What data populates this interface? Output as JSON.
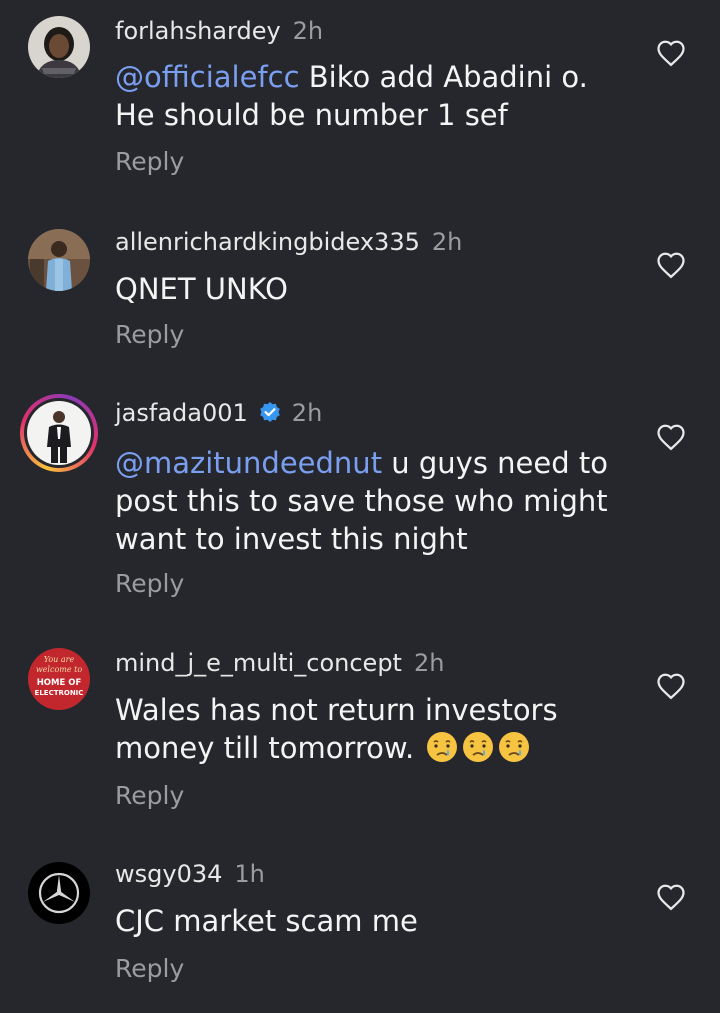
{
  "comments": [
    {
      "username": "forlahshardey",
      "time": "2h",
      "mention": "@officialefcc",
      "text": " Biko add Abadini o. He should be number 1 sef",
      "reply_label": "Reply",
      "avatar_icon": "user-avatar-woman",
      "like_icon": "heart-outline-icon"
    },
    {
      "username": "allenrichardkingbidex335",
      "time": "2h",
      "mention": "",
      "text": "QNET UNKO",
      "reply_label": "Reply",
      "avatar_icon": "user-avatar-man-blue",
      "like_icon": "heart-outline-icon"
    },
    {
      "username": "jasfada001",
      "time": "2h",
      "verified": true,
      "mention": "@mazitundeednut",
      "text": " u guys need to post this to save those who might want to invest this night",
      "reply_label": "Reply",
      "avatar_icon": "user-avatar-man-suit-story-ring",
      "like_icon": "heart-outline-icon"
    },
    {
      "username": "mind_j_e_multi_concept",
      "time": "2h",
      "mention": "",
      "text": "Wales has not return investors money till tomorrow. ",
      "emojis": [
        "crying-face",
        "crying-face",
        "crying-face"
      ],
      "reply_label": "Reply",
      "avatar_logo_line1": "You are",
      "avatar_logo_line2": "welcome to",
      "avatar_logo_line3": "HOME OF",
      "avatar_logo_line4": "ELECTRONIC",
      "like_icon": "heart-outline-icon"
    },
    {
      "username": "wsgy034",
      "time": "1h",
      "mention": "",
      "text": "CJC market scam me",
      "reply_label": "Reply",
      "avatar_icon": "mercedes-logo",
      "like_icon": "heart-outline-icon"
    }
  ],
  "colors": {
    "background": "#25272c",
    "mention": "#7b9ff0",
    "secondary_text": "#9a9ca2",
    "verified_badge": "#3797f0"
  }
}
